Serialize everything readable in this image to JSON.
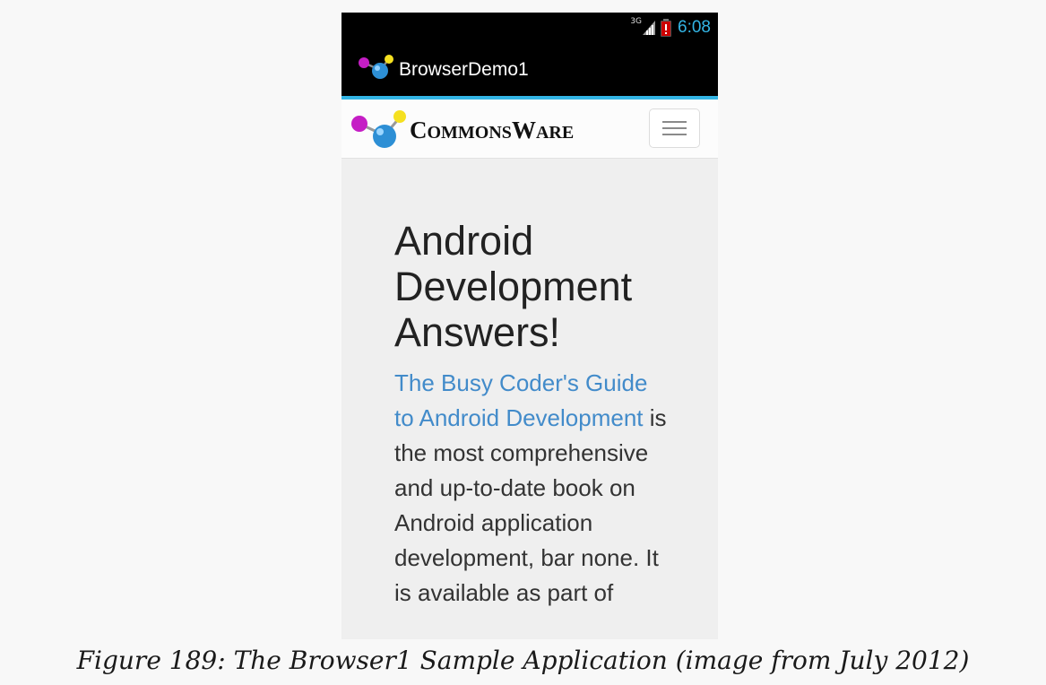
{
  "status_bar": {
    "network_type": "3G",
    "time": "6:08",
    "icons": [
      "signal-icon",
      "battery-low-icon"
    ],
    "colors": {
      "clock": "#33b5e5",
      "battery_warning": "#cc0000"
    }
  },
  "action_bar": {
    "title": "BrowserDemo1",
    "icon": "app-molecule-icon",
    "colors": {
      "background": "#000000",
      "underline": "#33b5e5"
    }
  },
  "site": {
    "brand": {
      "c": "C",
      "ommons": "OMMONS",
      "w": "W",
      "are": "ARE"
    },
    "menu_icon": "hamburger-icon",
    "headline": [
      "Android",
      "Development",
      "Answers!"
    ],
    "link_text": "The Busy Coder's Guide to Android Development",
    "body_text": " is the most comprehensive and up-to-date book on Android application development, bar none. It is available as part of",
    "colors": {
      "link": "#428bca",
      "background": "#efefef"
    }
  },
  "caption": "Figure 189: The Browser1 Sample Application (image from July 2012)"
}
